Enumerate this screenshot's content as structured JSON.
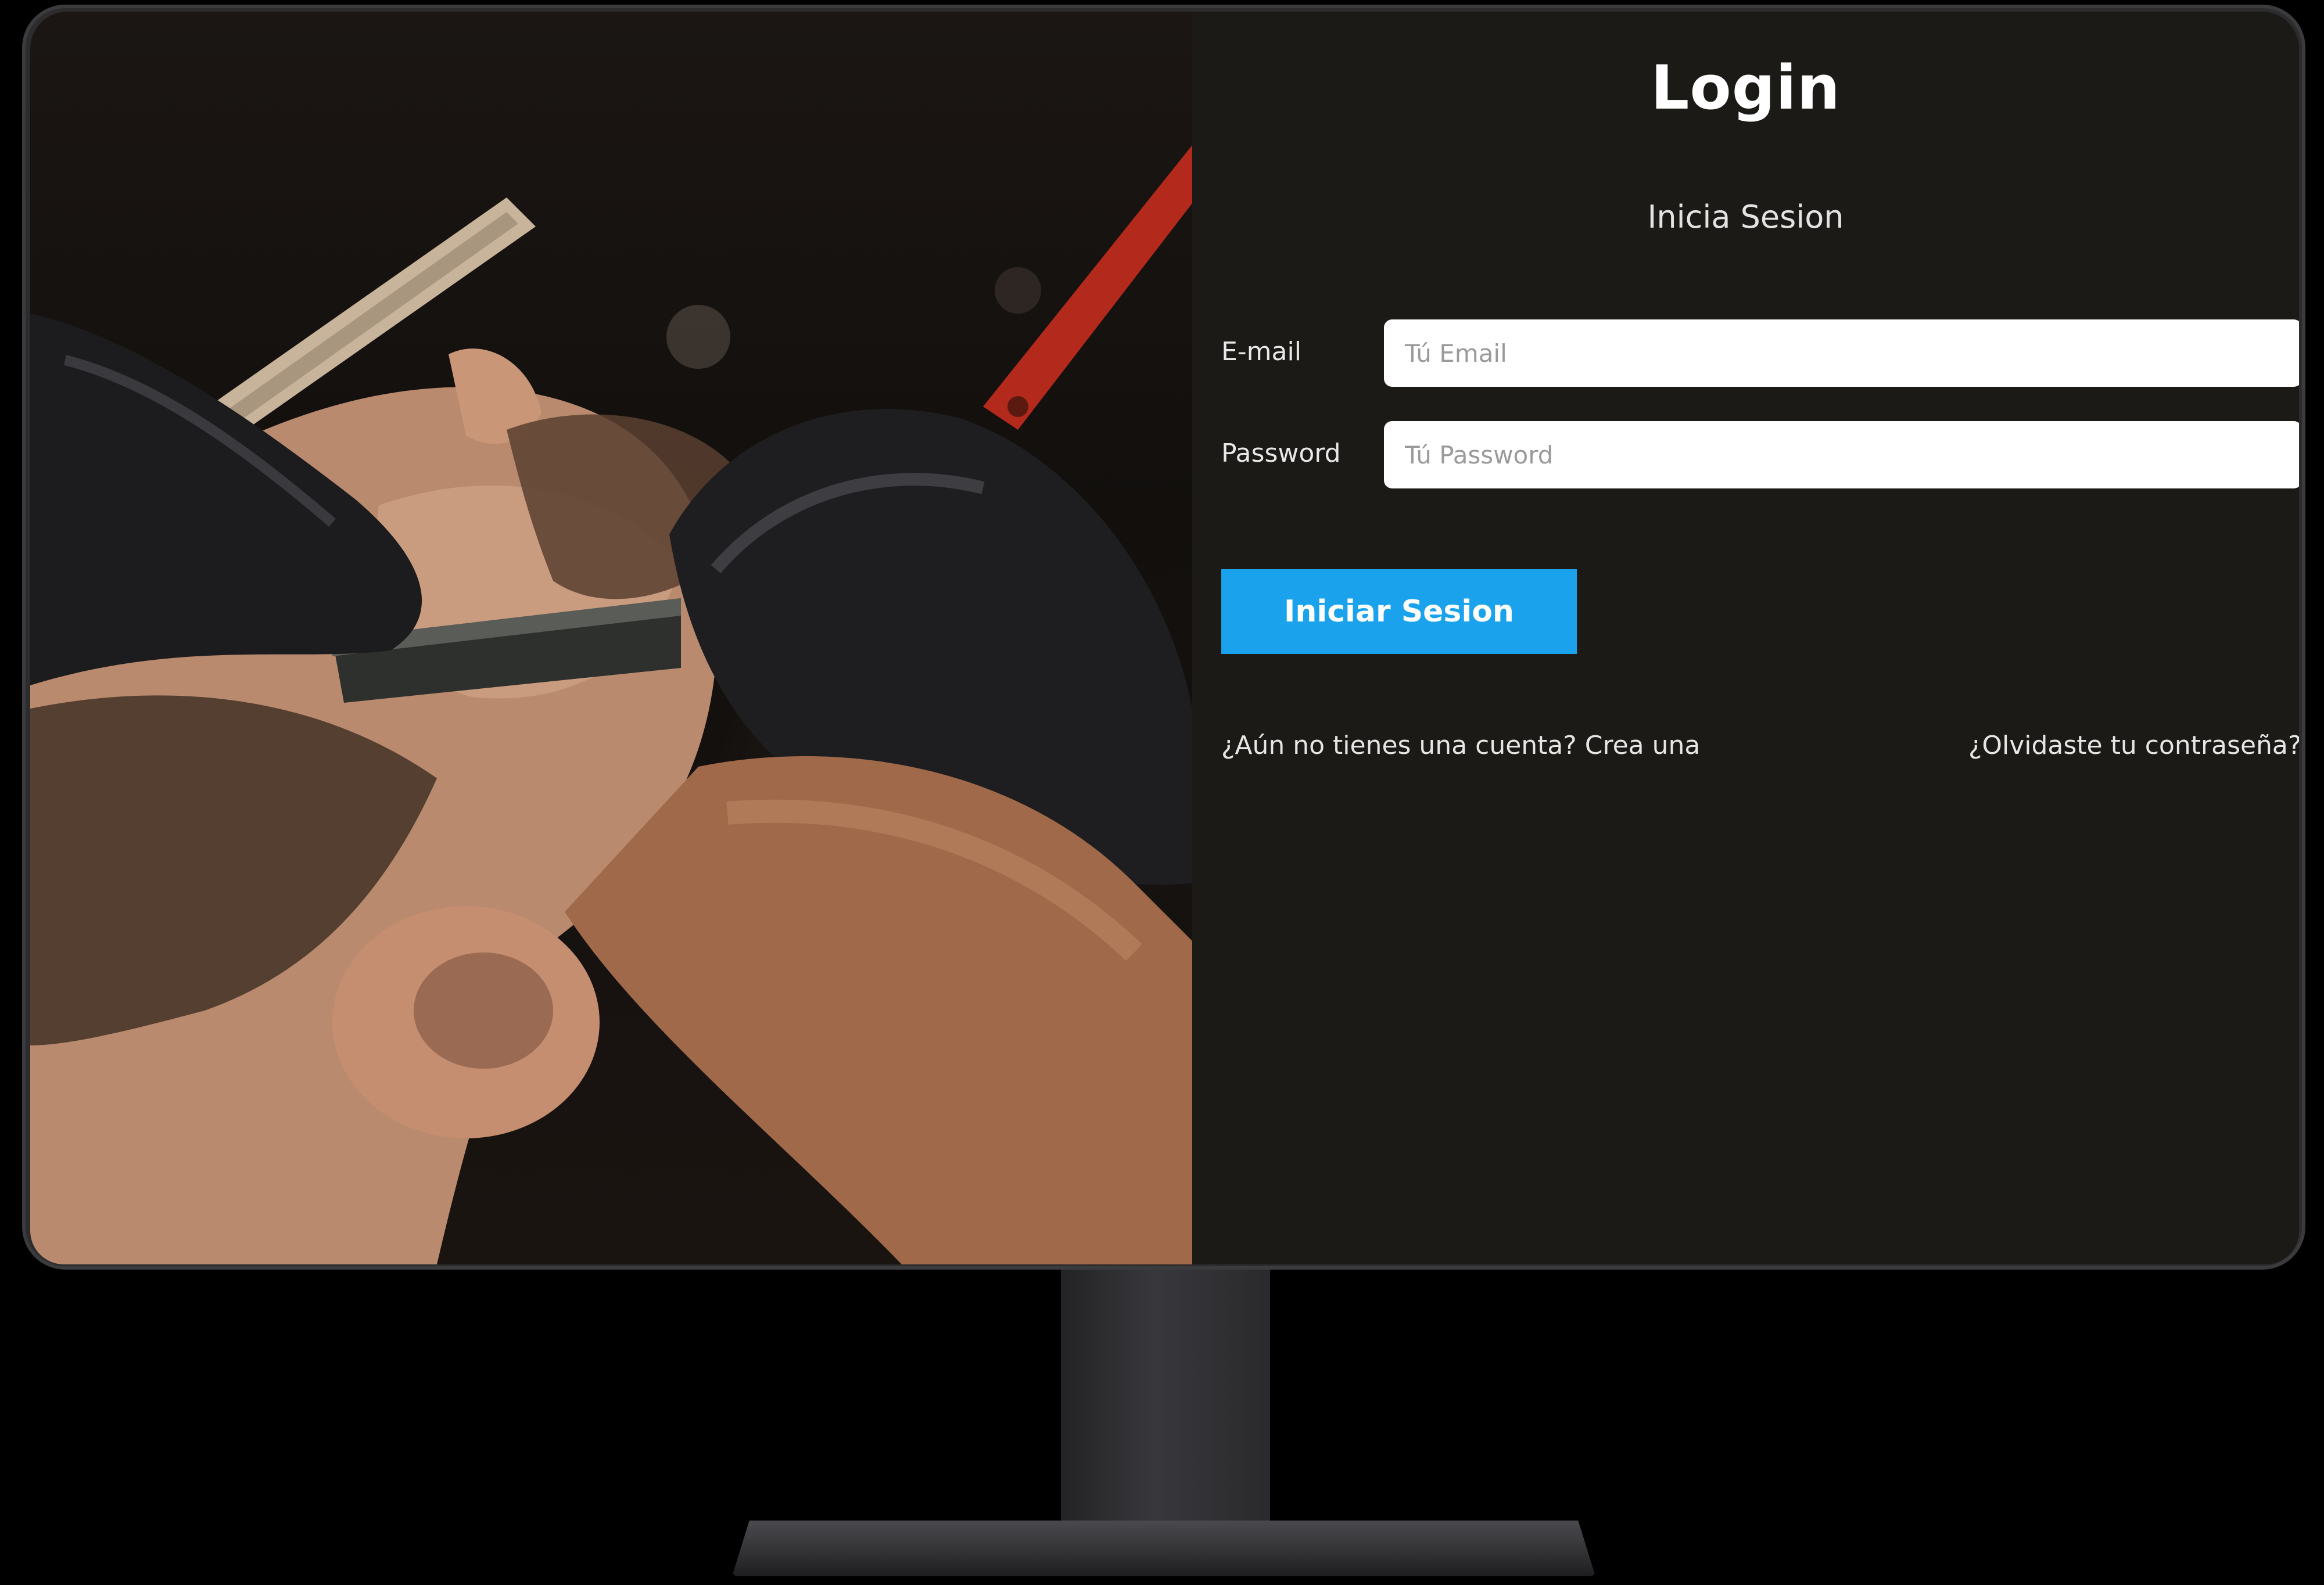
{
  "login": {
    "title": "Login",
    "subtitle": "Inicia Sesion",
    "email_label": "E-mail",
    "email_placeholder": "Tú Email",
    "password_label": "Password",
    "password_placeholder": "Tú Password",
    "submit_label": "Iniciar Sesion",
    "signup_link": "¿Aún no tienes una cuenta? Crea una",
    "forgot_link": "¿Olvidaste tu contraseña?"
  },
  "colors": {
    "panel_background": "#1c1a17",
    "button": "#1aa3ec",
    "text": "#ffffff"
  },
  "icons": {
    "hero_image": "barber-shaving-photo"
  }
}
